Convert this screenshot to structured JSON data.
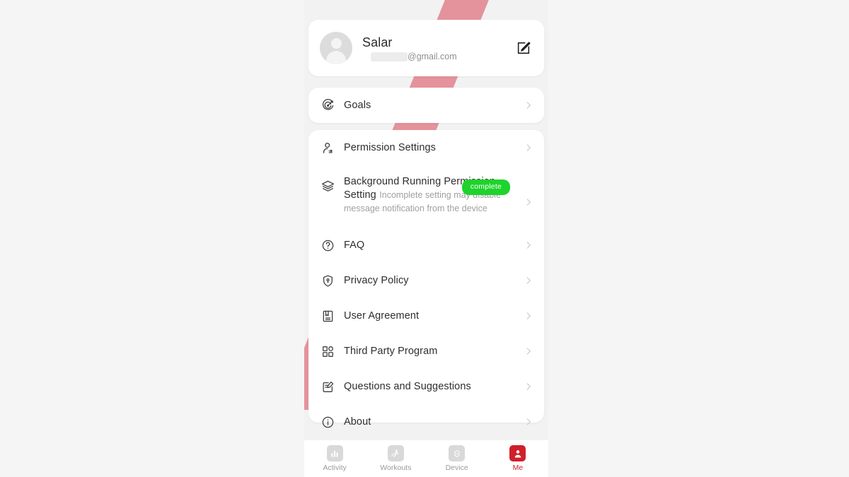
{
  "theme": {
    "page_background": "#f5f5f5",
    "app_background": "#f2f2f2",
    "card_background": "#ffffff",
    "accent_red": "#d0202a",
    "ribbon_pink": "#e4929c",
    "badge_green": "#1ed32b",
    "text_primary": "#2e2e2e",
    "text_muted": "#a0a0a0",
    "chevron_gray": "#cfcfcf"
  },
  "profile": {
    "name": "Salar",
    "email_redacted": "",
    "email_domain": "@gmail.com",
    "avatar_icon": "person-avatar-icon",
    "edit_icon": "edit-pencil-icon"
  },
  "goals_card": {
    "items": [
      {
        "icon": "target-goal-icon",
        "label": "Goals"
      }
    ]
  },
  "settings_card": {
    "items": [
      {
        "icon": "person-settings-icon",
        "label": "Permission Settings",
        "subtitle": "",
        "badge": ""
      },
      {
        "icon": "layers-icon",
        "label": "Background Running Permission Setting",
        "subtitle": "Incomplete setting may disable message notification from the device",
        "badge": "complete"
      },
      {
        "icon": "question-circle-icon",
        "label": "FAQ",
        "subtitle": "",
        "badge": ""
      },
      {
        "icon": "shield-lock-icon",
        "label": "Privacy Policy",
        "subtitle": "",
        "badge": ""
      },
      {
        "icon": "document-book-icon",
        "label": "User Agreement",
        "subtitle": "",
        "badge": ""
      },
      {
        "icon": "grid-squares-icon",
        "label": "Third Party Program",
        "subtitle": "",
        "badge": ""
      },
      {
        "icon": "edit-note-icon",
        "label": "Questions and Suggestions",
        "subtitle": "",
        "badge": ""
      },
      {
        "icon": "info-circle-icon",
        "label": "About",
        "subtitle": "",
        "badge": ""
      }
    ]
  },
  "bottom_nav": {
    "items": [
      {
        "icon": "bar-chart-icon",
        "label": "Activity",
        "active": false
      },
      {
        "icon": "running-person-icon",
        "label": "Workouts",
        "active": false
      },
      {
        "icon": "watch-device-icon",
        "label": "Device",
        "active": false
      },
      {
        "icon": "person-icon",
        "label": "Me",
        "active": true
      }
    ]
  }
}
